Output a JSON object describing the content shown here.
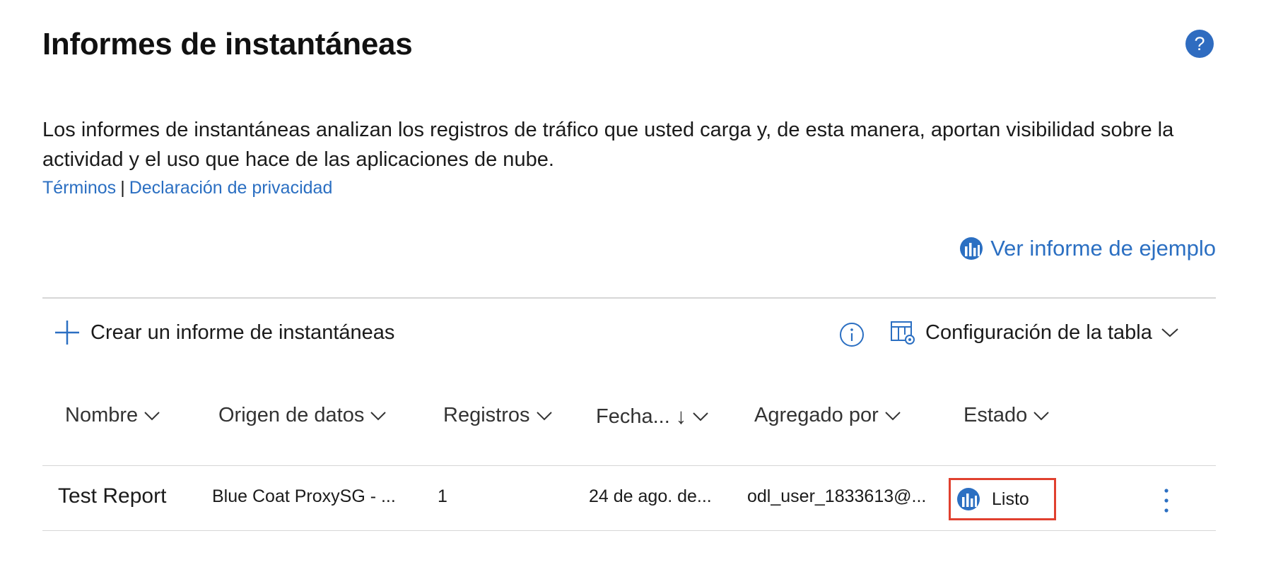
{
  "header": {
    "title": "Informes de instantáneas",
    "help_icon": "question-circle-icon",
    "help_glyph": "?"
  },
  "description": {
    "text": "Los informes de instantáneas analizan los registros de tráfico que usted carga y, de esta manera, aportan visibilidad sobre la actividad y el uso que hace de las aplicaciones de nube.",
    "terms_link": "Términos",
    "separator": "|",
    "privacy_link": "Declaración de privacidad"
  },
  "sample_report": {
    "label": "Ver informe de ejemplo",
    "icon": "report-chart-icon"
  },
  "toolbar": {
    "create_label": "Crear un informe de instantáneas",
    "create_icon": "plus-icon",
    "info_icon": "info-circle-icon",
    "table_config_label": "Configuración de la tabla",
    "table_config_icon": "table-settings-icon",
    "chevron_icon": "chevron-down-icon"
  },
  "table": {
    "columns": [
      {
        "label": "Nombre"
      },
      {
        "label": "Origen de datos"
      },
      {
        "label": "Registros"
      },
      {
        "label": "Fecha...",
        "sort_glyph": "↓"
      },
      {
        "label": "Agregado por"
      },
      {
        "label": "Estado"
      }
    ],
    "rows": [
      {
        "name": "Test Report",
        "data_source": "Blue Coat ProxySG - ...",
        "records": "1",
        "date": "24 de ago. de...",
        "added_by": "odl_user_1833613@...",
        "status": "Listo",
        "status_icon": "report-chart-icon",
        "more_icon": "more-vertical-icon"
      }
    ]
  },
  "colors": {
    "accent": "#2b6fc2",
    "highlight_border": "#e0402f",
    "divider": "#d6d6d6"
  }
}
